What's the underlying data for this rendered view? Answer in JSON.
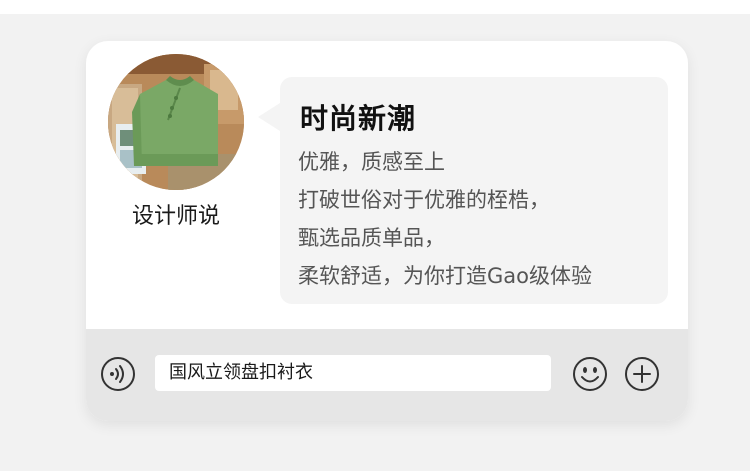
{
  "speaker": {
    "name": "设计师说",
    "avatar_icon": "green-shirt-photo"
  },
  "message": {
    "title": "时尚新潮",
    "lines": [
      "优雅，质感至上",
      "打破世俗对于优雅的桎梏，",
      "甄选品质单品，",
      "柔软舒适，为你打造Gao级体验"
    ]
  },
  "input_bar": {
    "voice_icon": "voice-icon",
    "text_value": "国风立领盘扣衬衣",
    "emoji_icon": "smiley-icon",
    "plus_icon": "plus-icon"
  },
  "colors": {
    "page_background": "#f2f2f2",
    "card_background": "#ffffff",
    "bubble_background": "#f4f4f4",
    "input_bar_background": "#e6e6e6",
    "shirt_green": "#7aa866",
    "icon_stroke": "#333333"
  }
}
